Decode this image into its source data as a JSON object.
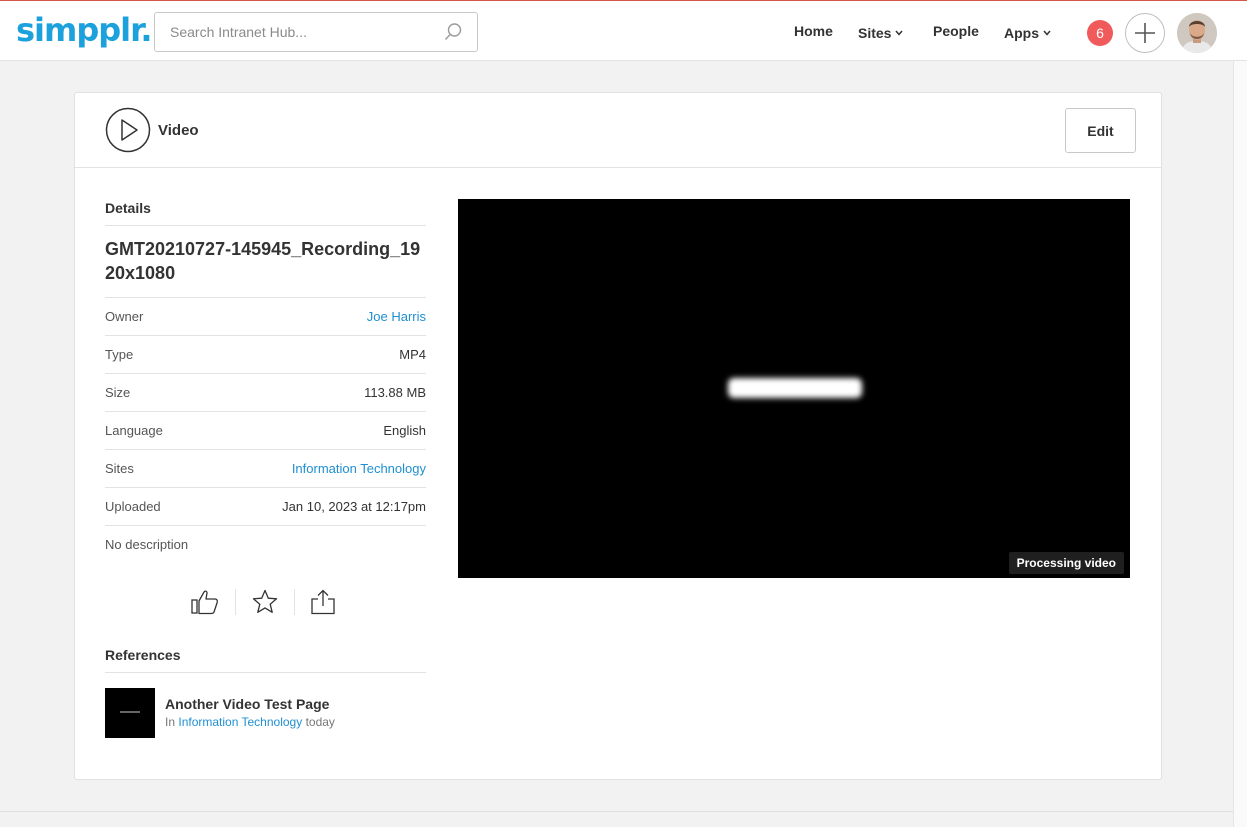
{
  "header": {
    "logo": "simpplr.",
    "search_placeholder": "Search Intranet Hub...",
    "nav": [
      {
        "label": "Home"
      },
      {
        "label": "Sites"
      },
      {
        "label": "People"
      },
      {
        "label": "Apps"
      }
    ],
    "notification_count": "6"
  },
  "card": {
    "type_label": "Video",
    "edit_label": "Edit"
  },
  "details": {
    "heading": "Details",
    "title": "GMT20210727-145945_Recording_1920x1080",
    "rows": [
      {
        "label": "Owner",
        "value": "Joe Harris"
      },
      {
        "label": "Type",
        "value": "MP4"
      },
      {
        "label": "Size",
        "value": "113.88 MB"
      },
      {
        "label": "Language",
        "value": "English"
      },
      {
        "label": "Sites",
        "value": "Information Technology"
      },
      {
        "label": "Uploaded",
        "value": "Jan 10, 2023 at 12:17pm"
      }
    ],
    "description": "No description"
  },
  "references": {
    "heading": "References",
    "items": [
      {
        "title": "Another Video Test Page",
        "prefix": "In",
        "site": "Information Technology",
        "when": "today"
      }
    ]
  },
  "video": {
    "status": "Processing video"
  },
  "colors": {
    "brand": "#1da1dc",
    "link": "#1f8fd1",
    "badge": "#f05a5a"
  }
}
